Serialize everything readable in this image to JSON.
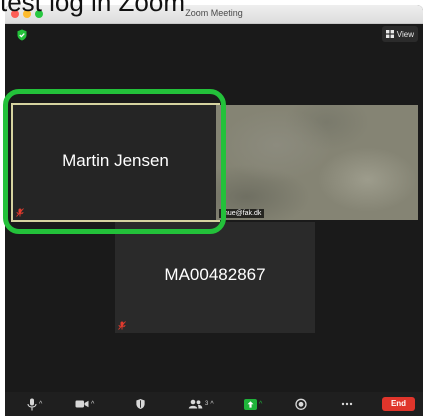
{
  "overlay": {
    "text": "test log in Zoom"
  },
  "window": {
    "title": "Zoom Meeting"
  },
  "header": {
    "view_label": "View"
  },
  "participants": [
    {
      "name": "Martin Jensen",
      "video": false,
      "muted": true
    },
    {
      "label": "mue@fak.dk",
      "video": true
    },
    {
      "name": "MA00482867",
      "video": false,
      "muted": true
    }
  ],
  "toolbar": {
    "participants_count": "3",
    "end_label": "End"
  },
  "colors": {
    "highlight": "#23c13a",
    "end_button": "#e0352b",
    "share_button": "#1fb33a",
    "active_speaker_border": "#d6d3a0"
  }
}
